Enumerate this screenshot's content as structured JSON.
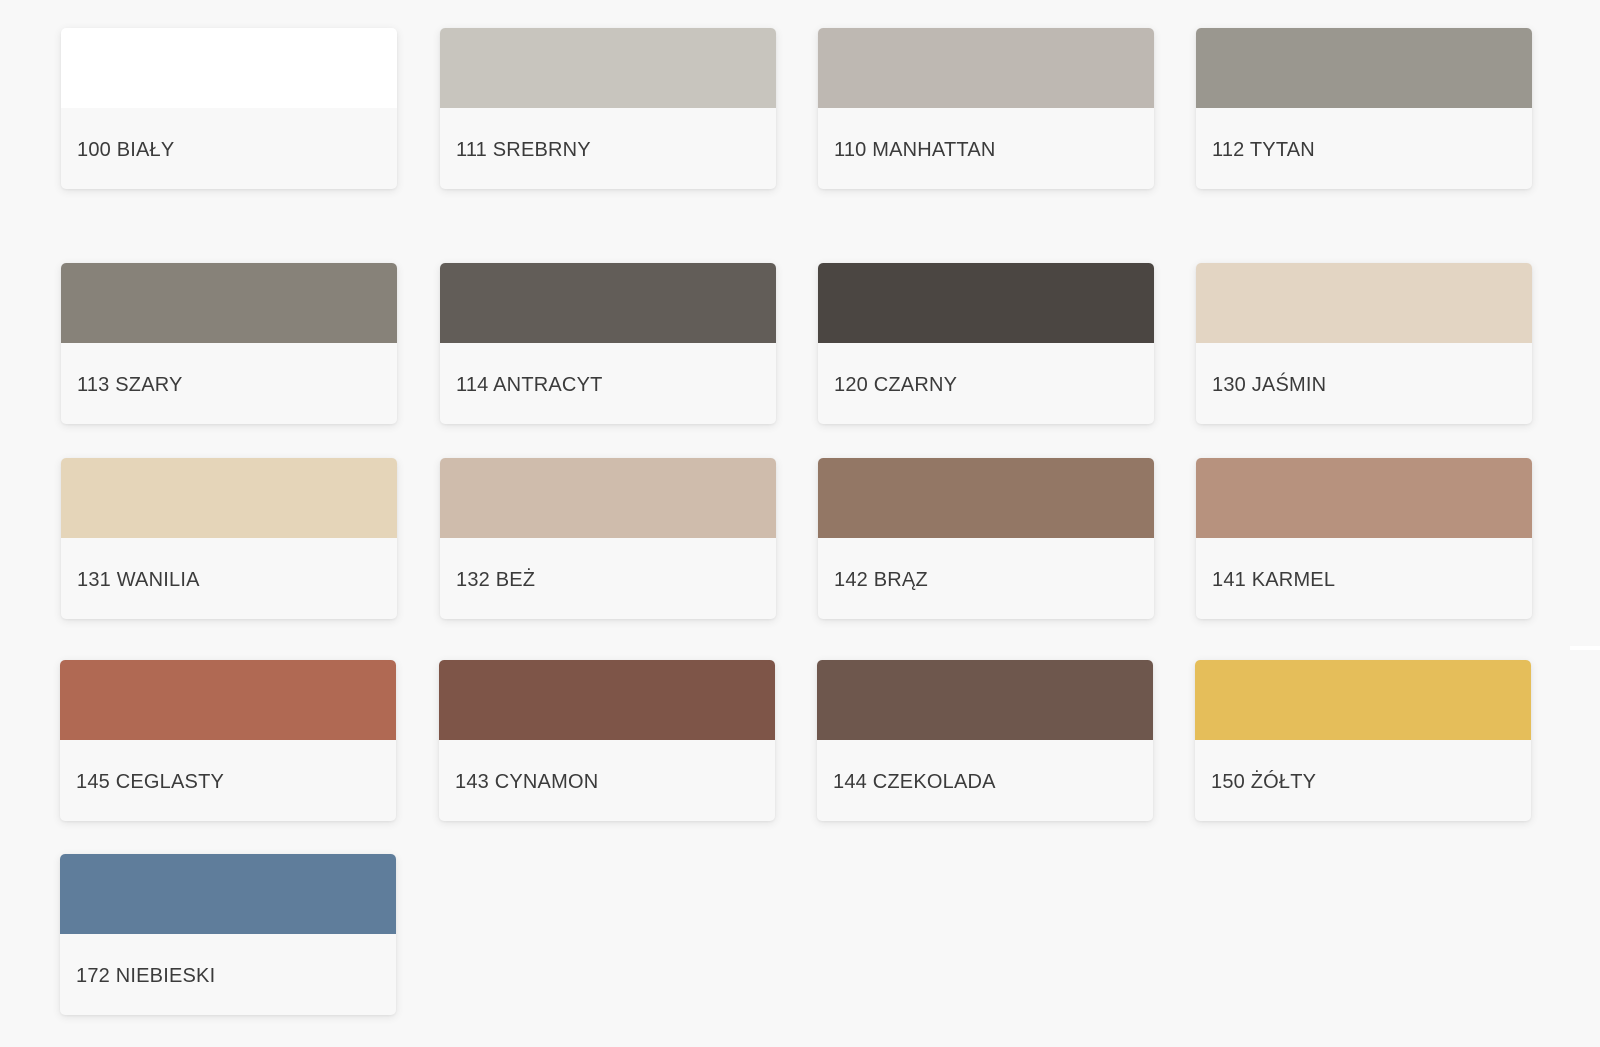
{
  "swatches": [
    {
      "code": "100",
      "name": "BIAŁY",
      "label": "100 BIAŁY",
      "color": "#ffffff"
    },
    {
      "code": "111",
      "name": "SREBRNY",
      "label": "111 SREBRNY",
      "color": "#c8c5be"
    },
    {
      "code": "110",
      "name": "MANHATTAN",
      "label": "110 MANHATTAN",
      "color": "#beb8b2"
    },
    {
      "code": "112",
      "name": "TYTAN",
      "label": "112 TYTAN",
      "color": "#9a978f"
    },
    {
      "code": "113",
      "name": "SZARY",
      "label": "113 SZARY",
      "color": "#878279"
    },
    {
      "code": "114",
      "name": "ANTRACYT",
      "label": "114 ANTRACYT",
      "color": "#625d58"
    },
    {
      "code": "120",
      "name": "CZARNY",
      "label": "120 CZARNY",
      "color": "#4b4642"
    },
    {
      "code": "130",
      "name": "JAŚMIN",
      "label": "130 JAŚMIN",
      "color": "#e3d5c3"
    },
    {
      "code": "131",
      "name": "WANILIA",
      "label": "131 WANILIA",
      "color": "#e5d5b9"
    },
    {
      "code": "132",
      "name": "BEŻ",
      "label": "132 BEŻ",
      "color": "#cfbcac"
    },
    {
      "code": "142",
      "name": "BRĄZ",
      "label": "142 BRĄZ",
      "color": "#937765"
    },
    {
      "code": "141",
      "name": "KARMEL",
      "label": "141 KARMEL",
      "color": "#b7927e"
    },
    {
      "code": "145",
      "name": "CEGLASTY",
      "label": "145 CEGLASTY",
      "color": "#b06953"
    },
    {
      "code": "143",
      "name": "CYNAMON",
      "label": "143 CYNAMON",
      "color": "#7e5548"
    },
    {
      "code": "144",
      "name": "CZEKOLADA",
      "label": "144 CZEKOLADA",
      "color": "#6e574d"
    },
    {
      "code": "150",
      "name": "ŻÓŁTY",
      "label": "150 ŻÓŁTY",
      "color": "#e5be5a"
    },
    {
      "code": "172",
      "name": "NIEBIESKI",
      "label": "172 NIEBIESKI",
      "color": "#5f7d9b"
    }
  ]
}
